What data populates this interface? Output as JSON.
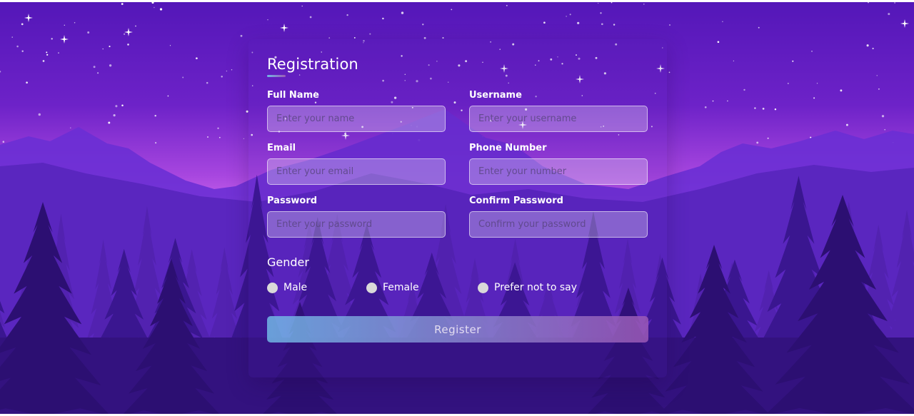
{
  "form": {
    "title": "Registration",
    "fields": [
      {
        "label": "Full Name",
        "placeholder": "Enter your name"
      },
      {
        "label": "Username",
        "placeholder": "Enter your username"
      },
      {
        "label": "Email",
        "placeholder": "Enter your email"
      },
      {
        "label": "Phone Number",
        "placeholder": "Enter your number"
      },
      {
        "label": "Password",
        "placeholder": "Enter your password"
      },
      {
        "label": "Confirm Password",
        "placeholder": "Confirm your password"
      }
    ],
    "gender": {
      "title": "Gender",
      "options": [
        "Male",
        "Female",
        "Prefer not to say"
      ]
    },
    "submit_label": "Register"
  },
  "colors": {
    "sky_top": "#5a1bbd",
    "sky_horizon": "#c25ee8",
    "button_gradient_start": "#71b7e6",
    "button_gradient_end": "#9b59b6"
  }
}
